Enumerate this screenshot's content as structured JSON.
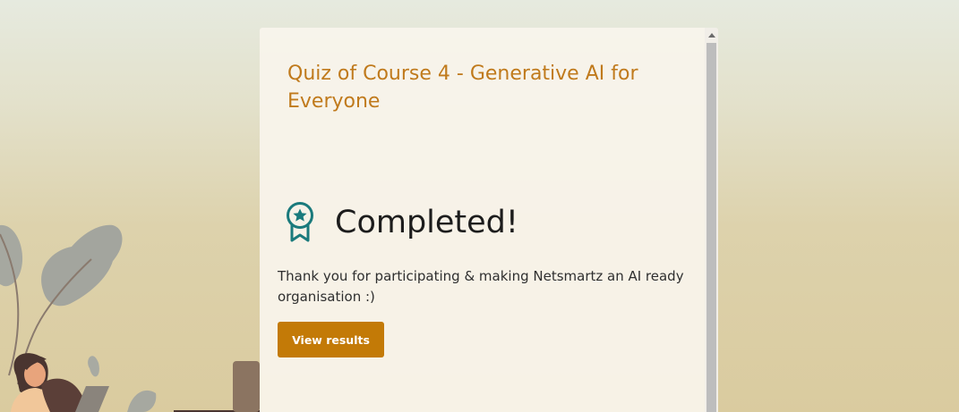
{
  "quiz": {
    "title": "Quiz of Course 4 - Generative AI for Everyone"
  },
  "completion": {
    "heading": "Completed!",
    "message": "Thank you for participating & making Netsmartz an AI ready organisation :)",
    "icon": "award-ribbon-icon",
    "icon_color": "#1a7a7c"
  },
  "actions": {
    "view_results_label": "View results"
  },
  "colors": {
    "title": "#c07a1c",
    "button": "#c37a07",
    "background_top": "#e6eadf",
    "background_bottom": "#dacb9f"
  }
}
